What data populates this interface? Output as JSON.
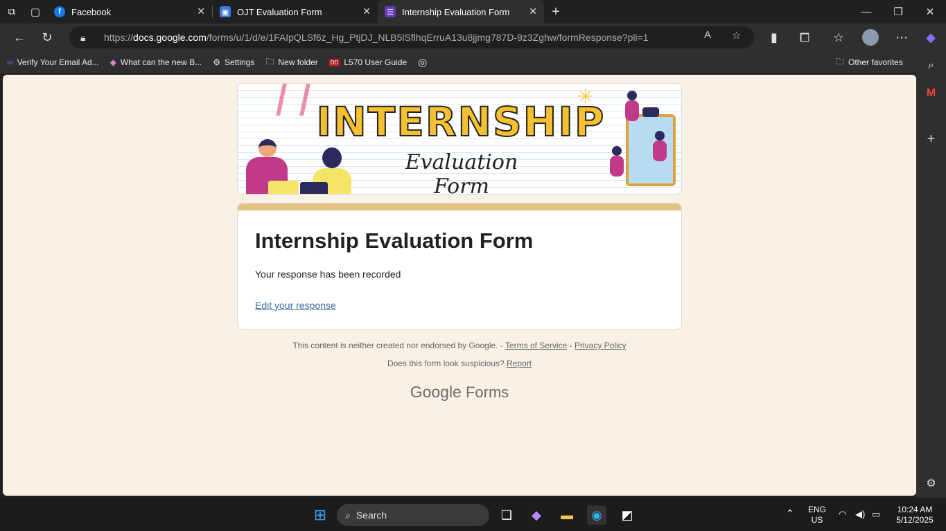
{
  "tabs": [
    {
      "label": "Facebook",
      "favicon_letter": "f",
      "favicon_color": "#1877f2"
    },
    {
      "label": "OJT Evaluation Form",
      "favicon_letter": "▣",
      "favicon_color": "#3a7be0"
    },
    {
      "label": "Internship Evaluation Form",
      "favicon_letter": "☰",
      "favicon_color": "#673ab7",
      "active": true
    }
  ],
  "address": {
    "prefix": "https://",
    "host": "docs.google.com",
    "path": "/forms/u/1/d/e/1FAIpQLSf6z_Hg_PtjDJ_NLB5lSflhqErruA13u8jjmg787D-9z3Zghw/formResponse?pli=1"
  },
  "bookmarks": [
    {
      "label": "Verify Your Email Ad...",
      "icon": "infinity-icon"
    },
    {
      "label": "What can the new B...",
      "icon": "copilot-icon"
    },
    {
      "label": "Settings",
      "icon": "gear-icon"
    },
    {
      "label": "New folder",
      "icon": "folder-icon"
    },
    {
      "label": "L570 User Guide",
      "icon": "pdf-icon"
    }
  ],
  "other_favorites": "Other favorites",
  "banner": {
    "title": "INTERNSHIP",
    "subtitle": "Evaluation Form"
  },
  "form": {
    "title": "Internship Evaluation Form",
    "message": "Your response has been recorded",
    "edit_link": "Edit your response"
  },
  "footer": {
    "disclaimer": "This content is neither created nor endorsed by Google. -",
    "terms": "Terms of Service",
    "dash": "-",
    "privacy": "Privacy Policy",
    "suspicious": "Does this form look suspicious?",
    "report": "Report",
    "brand_google": "Google",
    "brand_forms": "Forms"
  },
  "taskbar": {
    "search_label": "Search",
    "lang_top": "ENG",
    "lang_bottom": "US",
    "time": "10:24 AM",
    "date": "5/12/2025"
  },
  "colors": {
    "accent": "#e2c380",
    "page_bg": "#faf1e5",
    "link": "#3b6ea5"
  }
}
